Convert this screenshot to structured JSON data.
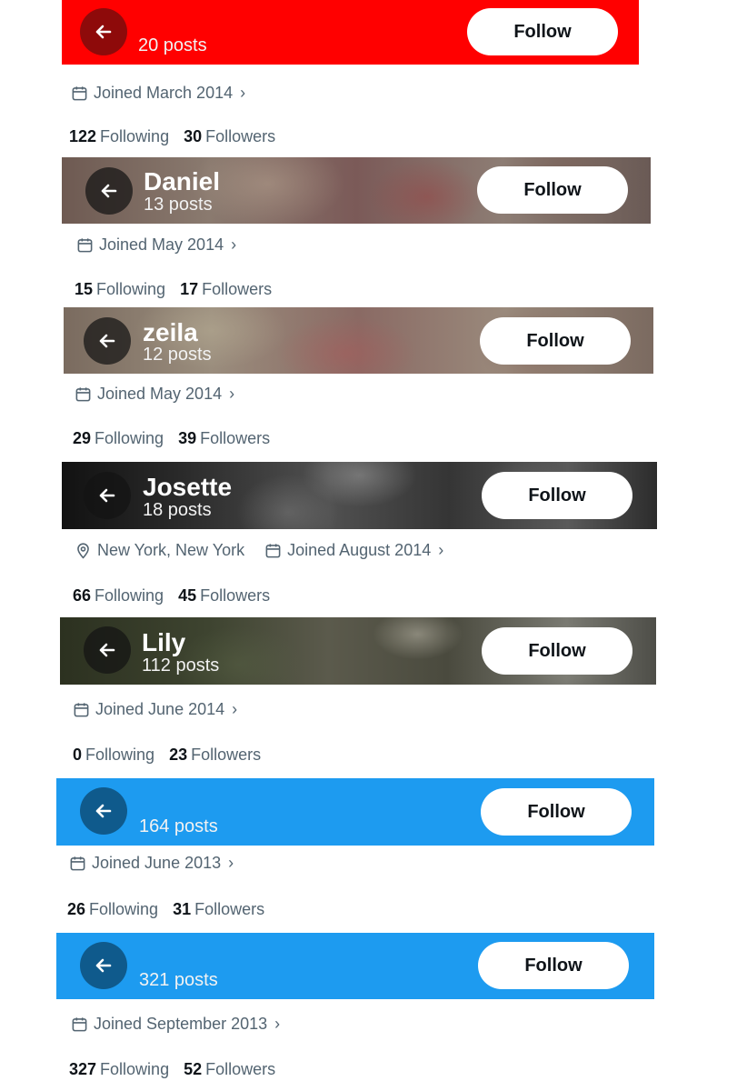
{
  "profiles": [
    {
      "name": "",
      "posts": "20 posts",
      "follow_label": "Follow",
      "meta": [
        {
          "icon": "calendar-icon",
          "text": "Joined March 2014"
        }
      ],
      "following_count": "122",
      "following_label": "Following",
      "followers_count": "30",
      "followers_label": "Followers",
      "banner_color": "#ff0000"
    },
    {
      "name": "Daniel",
      "posts": "13 posts",
      "follow_label": "Follow",
      "meta": [
        {
          "icon": "calendar-icon",
          "text": "Joined May 2014"
        }
      ],
      "following_count": "15",
      "following_label": "Following",
      "followers_count": "17",
      "followers_label": "Followers"
    },
    {
      "name": "zeila",
      "posts": "12 posts",
      "follow_label": "Follow",
      "meta": [
        {
          "icon": "calendar-icon",
          "text": "Joined May 2014"
        }
      ],
      "following_count": "29",
      "following_label": "Following",
      "followers_count": "39",
      "followers_label": "Followers"
    },
    {
      "name": "Josette",
      "posts": "18 posts",
      "follow_label": "Follow",
      "meta": [
        {
          "icon": "location-pin-icon",
          "text": "New York, New York"
        },
        {
          "icon": "calendar-icon",
          "text": "Joined August 2014"
        }
      ],
      "following_count": "66",
      "following_label": "Following",
      "followers_count": "45",
      "followers_label": "Followers"
    },
    {
      "name": "Lily",
      "posts": "112 posts",
      "follow_label": "Follow",
      "meta": [
        {
          "icon": "calendar-icon",
          "text": "Joined June 2014"
        }
      ],
      "following_count": "0",
      "following_label": "Following",
      "followers_count": "23",
      "followers_label": "Followers"
    },
    {
      "name": "",
      "posts": "164 posts",
      "follow_label": "Follow",
      "meta": [
        {
          "icon": "calendar-icon",
          "text": "Joined June 2013"
        }
      ],
      "following_count": "26",
      "following_label": "Following",
      "followers_count": "31",
      "followers_label": "Followers",
      "banner_color": "#1d9bf0"
    },
    {
      "name": "",
      "posts": "321 posts",
      "follow_label": "Follow",
      "meta": [
        {
          "icon": "calendar-icon",
          "text": "Joined September 2013"
        }
      ],
      "following_count": "327",
      "following_label": "Following",
      "followers_count": "52",
      "followers_label": "Followers",
      "banner_color": "#1d9bf0"
    }
  ],
  "icons": {
    "back": "arrow-left-icon",
    "calendar": "calendar-icon",
    "location": "location-pin-icon",
    "chevron": "chevron-right-icon"
  },
  "chevron_glyph": "›"
}
